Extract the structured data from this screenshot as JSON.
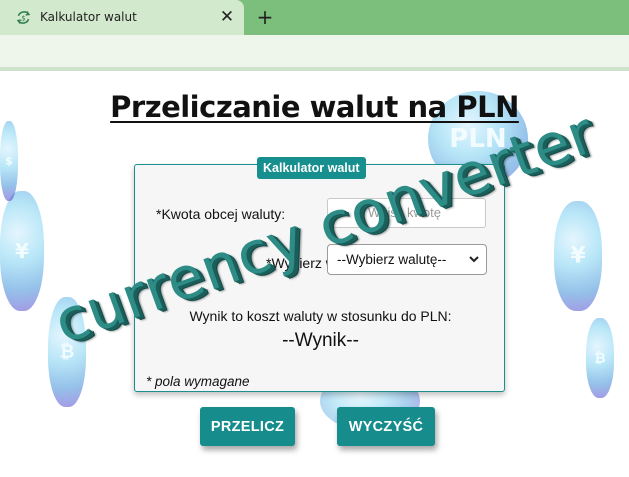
{
  "browser": {
    "tab_title": "Kalkulator walut",
    "tab_close": "✕",
    "new_tab": "+"
  },
  "page": {
    "title": "Przeliczanie walut na PLN",
    "calculator": {
      "legend": "Kalkulator walut",
      "amount_label": "*Kwota obcej waluty:",
      "amount_placeholder": "Wpisz kwotę",
      "currency_label": "*Wybierz walutę:",
      "currency_selected": "--Wybierz walutę--",
      "currency_chevron": "⌄",
      "result_caption": "Wynik to koszt waluty w stosunku do PLN:",
      "result_value": "--Wynik--",
      "required_note": "* pola wymagane"
    },
    "buttons": {
      "convert": "PRZELICZ",
      "clear": "WYCZYŚĆ"
    },
    "overlay_text": "currency converter",
    "background_coins": [
      "PLN",
      "¥",
      "¥",
      "₿",
      "₿",
      "$"
    ],
    "colors": {
      "accent": "#168c8c",
      "tab_bar": "#7cbf7c",
      "active_tab": "#d3e9cd"
    }
  }
}
